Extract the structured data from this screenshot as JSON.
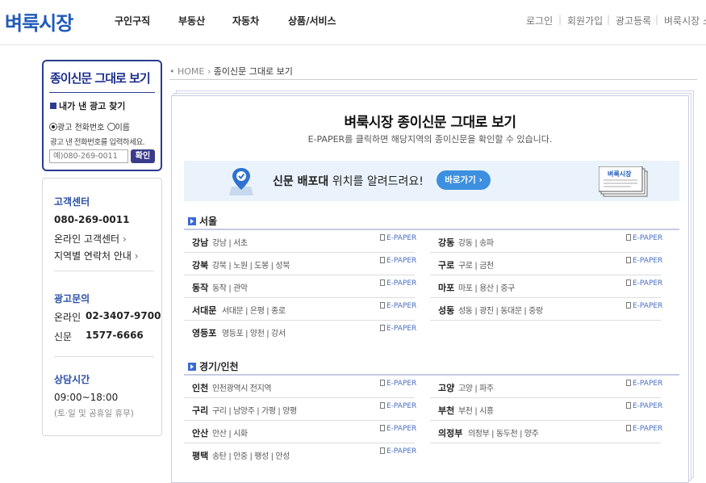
{
  "header": {
    "logo": "벼룩시장",
    "nav": [
      "구인구직",
      "부동산",
      "자동차",
      "상품/서비스"
    ],
    "util": [
      "로그인",
      "회원가입",
      "광고등록",
      "벼룩시장 소"
    ]
  },
  "sidebar": {
    "epaper_title": "종이신문 그대로 보기",
    "find_title": "내가 낸 광고 찾기",
    "radio_phone": "광고 전화번호",
    "radio_name": "이름",
    "hint": "광고 낸 전화번호를 입력하세요.",
    "phone_placeholder": "예)080-269-0011",
    "confirm": "확인",
    "cs_title": "고객센터",
    "cs_phone": "080-269-0011",
    "cs_online": "온라인 고객센터",
    "cs_region": "지역별 연락처 안내",
    "ad_title": "광고문의",
    "ad_online_label": "온라인",
    "ad_online_phone": "02-3407-9700",
    "ad_paper_label": "신문",
    "ad_paper_phone": "1577-6666",
    "hours_title": "상담시간",
    "hours": "09:00~18:00",
    "hours_note": "(토·일 및 공휴일 휴무)"
  },
  "breadcrumb": {
    "home": "HOME",
    "current": "종이신문 그대로 보기"
  },
  "main": {
    "title": "벼룩시장 종이신문 그대로 보기",
    "subtitle": "E-PAPER를 클릭하면 해당지역의 종이신문을 확인할 수 있습니다.",
    "banner_bold": "신문 배포대",
    "banner_rest": " 위치를 알려드려요!",
    "banner_button": "바로가기 ›",
    "paper_icon_label": "벼룩시장",
    "epaper_label": "E-PAPER",
    "regions": [
      {
        "title": "서울",
        "left": [
          {
            "name": "강남",
            "areas": "강남 | 서초"
          },
          {
            "name": "강북",
            "areas": "강북 | 노원 | 도봉 | 성북"
          },
          {
            "name": "동작",
            "areas": "동작 | 관악"
          },
          {
            "name": "서대문",
            "areas": "서대문 | 은평 | 종로"
          },
          {
            "name": "영등포",
            "areas": "영등포 | 양천 | 강서"
          }
        ],
        "right": [
          {
            "name": "강동",
            "areas": "강동 | 송파"
          },
          {
            "name": "구로",
            "areas": "구로 | 금천"
          },
          {
            "name": "마포",
            "areas": "마포 | 용산 | 중구"
          },
          {
            "name": "성동",
            "areas": "성동 | 광진 | 동대문 | 중랑"
          }
        ]
      },
      {
        "title": "경기/인천",
        "left": [
          {
            "name": "인천",
            "areas": "인천광역시 전지역"
          },
          {
            "name": "구리",
            "areas": "구리 | 남양주 | 가평 | 양평"
          },
          {
            "name": "안산",
            "areas": "안산 | 시화"
          },
          {
            "name": "평택",
            "areas": "송탄 | 안중 | 팽성 | 안성"
          }
        ],
        "right": [
          {
            "name": "고양",
            "areas": "고양 | 파주"
          },
          {
            "name": "부천",
            "areas": "부천 | 시흥"
          },
          {
            "name": "의정부",
            "areas": "의정부 | 동두천 | 양주"
          }
        ]
      }
    ]
  }
}
